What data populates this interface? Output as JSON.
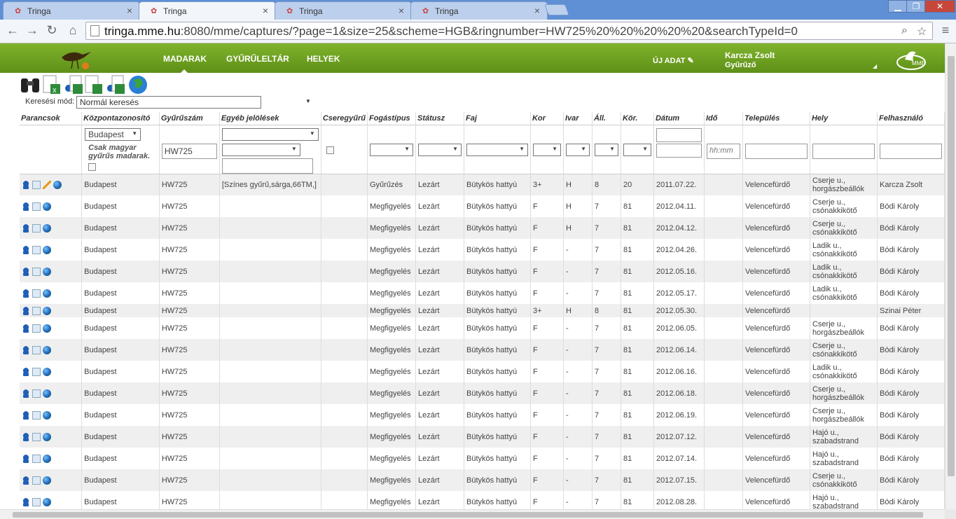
{
  "browser": {
    "tabs": [
      {
        "title": "Tringa",
        "active": false
      },
      {
        "title": "Tringa",
        "active": true
      },
      {
        "title": "Tringa",
        "active": false
      },
      {
        "title": "Tringa",
        "active": false
      }
    ],
    "url_host": "tringa.mme.hu",
    "url_rest": ":8080/mme/captures/?page=1&size=25&scheme=HGB&ringnumber=HW725%20%20%20%20%20&searchTypeId=0"
  },
  "header": {
    "nav": [
      "MADARAK",
      "GYŰRŰLELTÁR",
      "HELYEK"
    ],
    "new_data": "ÚJ ADAT",
    "user_name": "Karcza Zsolt",
    "user_role": "Gyűrűző",
    "accent": "#6fa221"
  },
  "search": {
    "label": "Keresési mód:",
    "mode": "Normál keresés"
  },
  "table": {
    "headers": [
      "Parancsok",
      "Központazonosító",
      "Gyűrűszám",
      "Egyéb jelölések",
      "Cseregyűrű",
      "Fogástípus",
      "Státusz",
      "Faj",
      "Kor",
      "Ivar",
      "Áll.",
      "Kör.",
      "Dátum",
      "Idő",
      "Település",
      "Hely",
      "Felhasználó"
    ],
    "filter": {
      "center": "Budapest",
      "only_hungarian": "Csak magyar gyűrűs madarak.",
      "ring": "HW725",
      "time_placeholder": "hh:mm"
    },
    "rows": [
      {
        "center": "Budapest",
        "ring": "HW725",
        "marks": "[Színes gyűrű,sárga,66TM,]",
        "catch": "Gyűrűzés",
        "status": "Lezárt",
        "species": "Bütykös hattyú",
        "age": "3+",
        "sex": "H",
        "state": "8",
        "circ": "20",
        "date": "2011.07.22.",
        "town": "Velencefürdő",
        "place": "Cserje u., horgászbeállók",
        "user": "Karcza Zsolt",
        "edit": true
      },
      {
        "center": "Budapest",
        "ring": "HW725",
        "marks": "",
        "catch": "Megfigyelés",
        "status": "Lezárt",
        "species": "Bütykös hattyú",
        "age": "F",
        "sex": "H",
        "state": "7",
        "circ": "81",
        "date": "2012.04.11.",
        "town": "Velencefürdő",
        "place": "Cserje u., csónakkikötő",
        "user": "Bódi Károly"
      },
      {
        "center": "Budapest",
        "ring": "HW725",
        "marks": "",
        "catch": "Megfigyelés",
        "status": "Lezárt",
        "species": "Bütykös hattyú",
        "age": "F",
        "sex": "H",
        "state": "7",
        "circ": "81",
        "date": "2012.04.12.",
        "town": "Velencefürdő",
        "place": "Cserje u., csónakkikötő",
        "user": "Bódi Károly"
      },
      {
        "center": "Budapest",
        "ring": "HW725",
        "marks": "",
        "catch": "Megfigyelés",
        "status": "Lezárt",
        "species": "Bütykös hattyú",
        "age": "F",
        "sex": "-",
        "state": "7",
        "circ": "81",
        "date": "2012.04.26.",
        "town": "Velencefürdő",
        "place": "Ladik u., csónakkikötő",
        "user": "Bódi Károly"
      },
      {
        "center": "Budapest",
        "ring": "HW725",
        "marks": "",
        "catch": "Megfigyelés",
        "status": "Lezárt",
        "species": "Bütykös hattyú",
        "age": "F",
        "sex": "-",
        "state": "7",
        "circ": "81",
        "date": "2012.05.16.",
        "town": "Velencefürdő",
        "place": "Ladik u., csónakkikötő",
        "user": "Bódi Károly"
      },
      {
        "center": "Budapest",
        "ring": "HW725",
        "marks": "",
        "catch": "Megfigyelés",
        "status": "Lezárt",
        "species": "Bütykös hattyú",
        "age": "F",
        "sex": "-",
        "state": "7",
        "circ": "81",
        "date": "2012.05.17.",
        "town": "Velencefürdő",
        "place": "Ladik u., csónakkikötő",
        "user": "Bódi Károly"
      },
      {
        "center": "Budapest",
        "ring": "HW725",
        "marks": "",
        "catch": "Megfigyelés",
        "status": "Lezárt",
        "species": "Bütykös hattyú",
        "age": "3+",
        "sex": "H",
        "state": "8",
        "circ": "81",
        "date": "2012.05.30.",
        "town": "Velencefürdő",
        "place": "",
        "user": "Szinai Péter",
        "short": true
      },
      {
        "center": "Budapest",
        "ring": "HW725",
        "marks": "",
        "catch": "Megfigyelés",
        "status": "Lezárt",
        "species": "Bütykös hattyú",
        "age": "F",
        "sex": "-",
        "state": "7",
        "circ": "81",
        "date": "2012.06.05.",
        "town": "Velencefürdő",
        "place": "Cserje u., horgászbeállók",
        "user": "Bódi Károly"
      },
      {
        "center": "Budapest",
        "ring": "HW725",
        "marks": "",
        "catch": "Megfigyelés",
        "status": "Lezárt",
        "species": "Bütykös hattyú",
        "age": "F",
        "sex": "-",
        "state": "7",
        "circ": "81",
        "date": "2012.06.14.",
        "town": "Velencefürdő",
        "place": "Cserje u., csónakkikötő",
        "user": "Bódi Károly"
      },
      {
        "center": "Budapest",
        "ring": "HW725",
        "marks": "",
        "catch": "Megfigyelés",
        "status": "Lezárt",
        "species": "Bütykös hattyú",
        "age": "F",
        "sex": "-",
        "state": "7",
        "circ": "81",
        "date": "2012.06.16.",
        "town": "Velencefürdő",
        "place": "Ladik u., csónakkikötő",
        "user": "Bódi Károly"
      },
      {
        "center": "Budapest",
        "ring": "HW725",
        "marks": "",
        "catch": "Megfigyelés",
        "status": "Lezárt",
        "species": "Bütykös hattyú",
        "age": "F",
        "sex": "-",
        "state": "7",
        "circ": "81",
        "date": "2012.06.18.",
        "town": "Velencefürdő",
        "place": "Cserje u., horgászbeállók",
        "user": "Bódi Károly"
      },
      {
        "center": "Budapest",
        "ring": "HW725",
        "marks": "",
        "catch": "Megfigyelés",
        "status": "Lezárt",
        "species": "Bütykös hattyú",
        "age": "F",
        "sex": "-",
        "state": "7",
        "circ": "81",
        "date": "2012.06.19.",
        "town": "Velencefürdő",
        "place": "Cserje u., horgászbeállók",
        "user": "Bódi Károly"
      },
      {
        "center": "Budapest",
        "ring": "HW725",
        "marks": "",
        "catch": "Megfigyelés",
        "status": "Lezárt",
        "species": "Bütykös hattyú",
        "age": "F",
        "sex": "-",
        "state": "7",
        "circ": "81",
        "date": "2012.07.12.",
        "town": "Velencefürdő",
        "place": "Hajó u., szabadstrand",
        "user": "Bódi Károly"
      },
      {
        "center": "Budapest",
        "ring": "HW725",
        "marks": "",
        "catch": "Megfigyelés",
        "status": "Lezárt",
        "species": "Bütykös hattyú",
        "age": "F",
        "sex": "-",
        "state": "7",
        "circ": "81",
        "date": "2012.07.14.",
        "town": "Velencefürdő",
        "place": "Hajó u., szabadstrand",
        "user": "Bódi Károly"
      },
      {
        "center": "Budapest",
        "ring": "HW725",
        "marks": "",
        "catch": "Megfigyelés",
        "status": "Lezárt",
        "species": "Bütykös hattyú",
        "age": "F",
        "sex": "-",
        "state": "7",
        "circ": "81",
        "date": "2012.07.15.",
        "town": "Velencefürdő",
        "place": "Cserje u., csónakkikötő",
        "user": "Bódi Károly"
      },
      {
        "center": "Budapest",
        "ring": "HW725",
        "marks": "",
        "catch": "Megfigyelés",
        "status": "Lezárt",
        "species": "Bütykös hattyú",
        "age": "F",
        "sex": "-",
        "state": "7",
        "circ": "81",
        "date": "2012.08.28.",
        "town": "Velencefürdő",
        "place": "Hajó u., szabadstrand",
        "user": "Bódi Károly"
      }
    ]
  }
}
